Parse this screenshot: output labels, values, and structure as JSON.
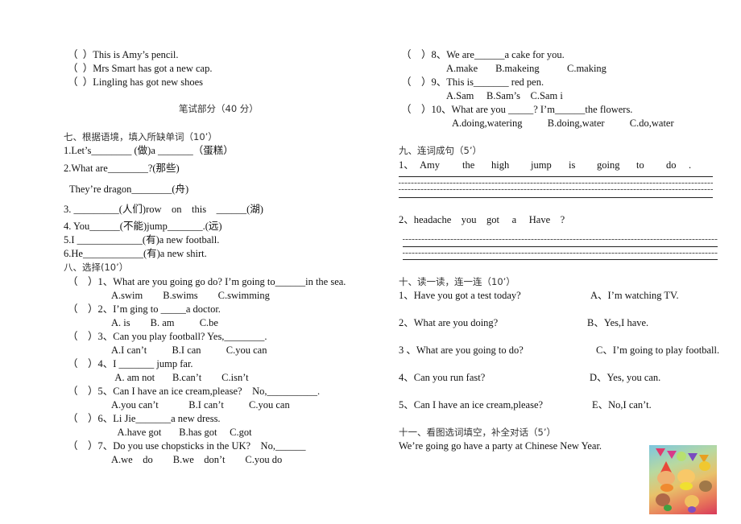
{
  "left": {
    "listening_items": [
      "（  ）This is Amy’s pencil.",
      "（  ）Mrs Smart has got a new cap.",
      "（  ）Lingling has got new shoes"
    ],
    "written_part_title": "笔试部分（40 分）",
    "section7": {
      "title": "七、根据语境，填入所缺单词（10’）",
      "items": [
        "1.Let’s________ (做)a _______（蛋糕）",
        "2.What are________?(那些)",
        "They’re dragon________(舟)",
        "3. _________(人们)row    on    this    ______(湖)",
        "4. You______(不能)jump_______.(远)",
        "5.I _____________(有)a new football.",
        "6.He____________(有)a new shirt."
      ]
    },
    "section8": {
      "title": "八、选择(10’）",
      "questions": [
        {
          "q": "（    ）1、What are you going go do? I’m going to______in the sea.",
          "options": "A.swim        B.swims        C.swimming"
        },
        {
          "q": "（    ）2、I’m ging to _____a doctor.",
          "options": "A. is        B. am          C.be"
        },
        {
          "q": "（    ）3、Can you play football? Yes,________.",
          "options": "A.I can’t          B.I can          C.you can"
        },
        {
          "q": "（    ）4、I _______ jump far.",
          "options": " A. am not       B.can’t        C.isn’t"
        },
        {
          "q": "（    ）5、Can I have an ice cream,please?    No,__________.",
          "options": "A.you can’t            B.I can’t          C.you can"
        },
        {
          "q": "（    ）6、Li Jie_______a new dress.",
          "options": "  A.have got       B.has got     C.got"
        },
        {
          "q": "（    ）7、Do you use chopsticks in the UK?    No,______",
          "options": "A.we    do        B.we    don’t        C.you do"
        }
      ]
    }
  },
  "right": {
    "section8_cont": [
      {
        "q": "（    ）8、We are______a cake for you.",
        "options": "A.make       B.makeing           C.making"
      },
      {
        "q": "（    ）9、This is_______ red pen.",
        "options": "A.Sam     B.Sam’s    C.Sam i"
      },
      {
        "q": "（    ）10、What are you _____? I’m______the flowers.",
        "options": "A.doing,watering          B.doing,water          C.do,water"
      }
    ],
    "section9": {
      "title": "九、连词成句（5’）",
      "item1_num": "1、",
      "item1_words": [
        "Amy",
        "the",
        "high",
        "jump",
        "is",
        "going",
        "to",
        "do",
        "."
      ],
      "item2": "2、headache    you    got     a     Have    ?"
    },
    "section10": {
      "title": "十、读一读，连一连（10’）",
      "questions": [
        "1、Have you got a test today?",
        "2、What are you doing?",
        "3 、What are you going to do?",
        "4、Can you run fast?",
        "5、Can I have an ice cream,please?"
      ],
      "answers": [
        "A、I’m watching TV.",
        "B、Yes,I have.",
        "C、I’m going to play football.",
        "D、Yes, you can.",
        "E、No,I can’t."
      ]
    },
    "section11": {
      "title": "十一、看图选词填空，补全对话（5’）",
      "sentence": "We’re going go have a party at Chinese New Year.",
      "image_alt": "children-party-illustration"
    }
  }
}
